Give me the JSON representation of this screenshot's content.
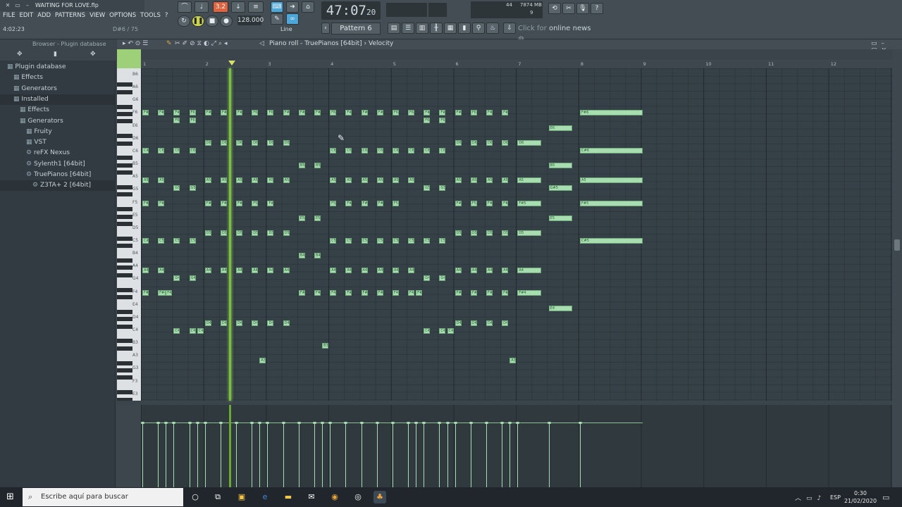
{
  "window": {
    "title": "WAITING FOR LOVE.flp",
    "hint_left": "4:02:23",
    "hint_right": "D#6 / 75"
  },
  "menu": [
    "FILE",
    "EDIT",
    "ADD",
    "PATTERNS",
    "VIEW",
    "OPTIONS",
    "TOOLS",
    "?"
  ],
  "transport": {
    "time": "47:07",
    "time_sub": "20",
    "tempo": "128.000",
    "snap": "3.2",
    "tool": "Line",
    "pattern": "Pattern 6"
  },
  "status": {
    "cpu": "44",
    "memory": "7874 MB",
    "polyphony": "9",
    "news_prefix": "Click for",
    "news_highlight": "online news"
  },
  "browser": {
    "title": "Browser - Plugin database",
    "items": [
      {
        "label": "Plugin database",
        "indent": 0,
        "icon": "folder-icon"
      },
      {
        "label": "Effects",
        "indent": 1,
        "icon": "folder-icon"
      },
      {
        "label": "Generators",
        "indent": 1,
        "icon": "folder-icon"
      },
      {
        "label": "Installed",
        "indent": 1,
        "icon": "folder-icon",
        "selected": true
      },
      {
        "label": "Effects",
        "indent": 2,
        "icon": "folder-icon"
      },
      {
        "label": "Generators",
        "indent": 2,
        "icon": "folder-icon"
      },
      {
        "label": "Fruity",
        "indent": 3,
        "icon": "folder-icon"
      },
      {
        "label": "VST",
        "indent": 3,
        "icon": "folder-icon"
      },
      {
        "label": "reFX Nexus",
        "indent": 3,
        "icon": "plugin-icon"
      },
      {
        "label": "Sylenth1 [64bit]",
        "indent": 3,
        "icon": "plugin-icon"
      },
      {
        "label": "TruePianos [64bit]",
        "indent": 3,
        "icon": "plugin-icon"
      },
      {
        "label": "Z3TA+ 2 [64bit]",
        "indent": 4,
        "icon": "plugin-icon",
        "selected": true
      }
    ]
  },
  "piano_roll": {
    "title": "Piano roll - TruePianos [64bit]",
    "separator": "›",
    "param": "Velocity",
    "bar_numbers": [
      "1",
      "2",
      "3",
      "4",
      "5",
      "6",
      "7",
      "8",
      "9",
      "10",
      "11",
      "12"
    ],
    "key_labels": [
      "B6",
      "A6",
      "G6",
      "F6",
      "E6",
      "D6",
      "C6",
      "B5",
      "A5",
      "G5",
      "F5",
      "E5",
      "D5",
      "C5",
      "B4",
      "A4",
      "G4",
      "F4",
      "E4",
      "D4",
      "C4",
      "B3",
      "A3",
      "G3",
      "F3",
      "E3"
    ],
    "notes": [
      {
        "p": "F6",
        "s": 0,
        "l": 0.4,
        "t": "F#6"
      },
      {
        "p": "F6",
        "s": 1,
        "l": 0.4,
        "t": "F#6"
      },
      {
        "p": "F6",
        "s": 2,
        "l": 0.4,
        "t": "F#6"
      },
      {
        "p": "F6",
        "s": 3,
        "l": 0.4,
        "t": "F6"
      },
      {
        "p": "F6",
        "s": 4,
        "l": 0.4,
        "t": "F#6"
      },
      {
        "p": "F6",
        "s": 5,
        "l": 0.4,
        "t": "F#6"
      },
      {
        "p": "F6",
        "s": 6,
        "l": 0.4,
        "t": "F#6"
      },
      {
        "p": "F6",
        "s": 7,
        "l": 0.4,
        "t": "F6"
      },
      {
        "p": "F6",
        "s": 8,
        "l": 0.4,
        "t": "F6"
      },
      {
        "p": "F6",
        "s": 9,
        "l": 0.4,
        "t": "F#6"
      },
      {
        "p": "F6",
        "s": 10,
        "l": 0.4,
        "t": "F#6"
      },
      {
        "p": "F6",
        "s": 11,
        "l": 0.4,
        "t": "F#6"
      },
      {
        "p": "F6",
        "s": 12,
        "l": 0.4,
        "t": "F6"
      },
      {
        "p": "F6",
        "s": 13,
        "l": 0.4,
        "t": "F#6"
      },
      {
        "p": "F6",
        "s": 14,
        "l": 0.4,
        "t": "F#6"
      },
      {
        "p": "F6",
        "s": 15,
        "l": 0.4,
        "t": "F#6"
      },
      {
        "p": "F6",
        "s": 16,
        "l": 0.4,
        "t": "F6"
      },
      {
        "p": "F6",
        "s": 17,
        "l": 0.4,
        "t": "F6"
      },
      {
        "p": "F6",
        "s": 18,
        "l": 0.4,
        "t": "F#6"
      },
      {
        "p": "F6",
        "s": 19,
        "l": 0.4,
        "t": "F#6"
      },
      {
        "p": "F6",
        "s": 20,
        "l": 0.4,
        "t": "F#6"
      },
      {
        "p": "F6",
        "s": 21,
        "l": 0.4,
        "t": "F6"
      },
      {
        "p": "F6",
        "s": 22,
        "l": 0.4,
        "t": "F#6"
      },
      {
        "p": "F6",
        "s": 23,
        "l": 0.4,
        "t": "F#6"
      },
      {
        "p": "F6",
        "s": 28,
        "l": 4,
        "t": "F#6"
      },
      {
        "p": "E6b",
        "s": 2,
        "l": 0.4,
        "t": "F6"
      },
      {
        "p": "E6b",
        "s": 3,
        "l": 0.4,
        "t": "F6"
      },
      {
        "p": "E6b",
        "s": 18,
        "l": 0.4,
        "t": "F6"
      },
      {
        "p": "E6b",
        "s": 19,
        "l": 0.4,
        "t": "F6"
      },
      {
        "p": "E6",
        "s": 26,
        "l": 1.5,
        "t": "E6"
      },
      {
        "p": "D6",
        "s": 4,
        "l": 0.4,
        "t": "D6"
      },
      {
        "p": "D6",
        "s": 5,
        "l": 0.4,
        "t": "D6"
      },
      {
        "p": "D6",
        "s": 6,
        "l": 0.4,
        "t": "D6"
      },
      {
        "p": "D6",
        "s": 7,
        "l": 0.4,
        "t": "D6"
      },
      {
        "p": "D6",
        "s": 8,
        "l": 0.4,
        "t": "D6"
      },
      {
        "p": "D6",
        "s": 9,
        "l": 0.4,
        "t": "D6"
      },
      {
        "p": "D6",
        "s": 20,
        "l": 0.4,
        "t": "D6"
      },
      {
        "p": "D6",
        "s": 21,
        "l": 0.4,
        "t": "D6"
      },
      {
        "p": "D6",
        "s": 22,
        "l": 0.4,
        "t": "D6"
      },
      {
        "p": "D6",
        "s": 23,
        "l": 0.4,
        "t": "D6"
      },
      {
        "p": "D6",
        "s": 24,
        "l": 1.5,
        "t": "D6"
      },
      {
        "p": "C6",
        "s": 0,
        "l": 0.4,
        "t": "C#6"
      },
      {
        "p": "C6",
        "s": 1,
        "l": 0.4,
        "t": "C6"
      },
      {
        "p": "C6",
        "s": 2,
        "l": 0.4,
        "t": "C6"
      },
      {
        "p": "C6",
        "s": 3,
        "l": 0.4,
        "t": "C6"
      },
      {
        "p": "C6",
        "s": 12,
        "l": 0.4,
        "t": "C6"
      },
      {
        "p": "C6",
        "s": 13,
        "l": 0.4,
        "t": "C6"
      },
      {
        "p": "C6",
        "s": 14,
        "l": 0.4,
        "t": "C6"
      },
      {
        "p": "C6",
        "s": 15,
        "l": 0.4,
        "t": "C6"
      },
      {
        "p": "C6",
        "s": 16,
        "l": 0.4,
        "t": "C6"
      },
      {
        "p": "C6",
        "s": 17,
        "l": 0.4,
        "t": "C6"
      },
      {
        "p": "C6",
        "s": 18,
        "l": 0.4,
        "t": "C6"
      },
      {
        "p": "C6",
        "s": 19,
        "l": 0.4,
        "t": "C6"
      },
      {
        "p": "C6",
        "s": 28,
        "l": 4,
        "t": "C#6"
      },
      {
        "p": "B5",
        "s": 10,
        "l": 0.4,
        "t": "B5"
      },
      {
        "p": "B5",
        "s": 11,
        "l": 0.4,
        "t": "B5"
      },
      {
        "p": "B5",
        "s": 26,
        "l": 1.5,
        "t": "B5"
      },
      {
        "p": "A5",
        "s": 0,
        "l": 0.4,
        "t": "A5"
      },
      {
        "p": "A5",
        "s": 1,
        "l": 0.4,
        "t": "A5"
      },
      {
        "p": "A5",
        "s": 4,
        "l": 0.4,
        "t": "A5"
      },
      {
        "p": "A5",
        "s": 5,
        "l": 0.4,
        "t": "A5"
      },
      {
        "p": "A5",
        "s": 6,
        "l": 0.4,
        "t": "A5"
      },
      {
        "p": "A5",
        "s": 7,
        "l": 0.4,
        "t": "A5"
      },
      {
        "p": "A5",
        "s": 8,
        "l": 0.4,
        "t": "A5"
      },
      {
        "p": "A5",
        "s": 9,
        "l": 0.4,
        "t": "A5"
      },
      {
        "p": "A5",
        "s": 12,
        "l": 0.4,
        "t": "A5"
      },
      {
        "p": "A5",
        "s": 13,
        "l": 0.4,
        "t": "A5"
      },
      {
        "p": "A5",
        "s": 14,
        "l": 0.4,
        "t": "A5"
      },
      {
        "p": "A5",
        "s": 15,
        "l": 0.4,
        "t": "A5"
      },
      {
        "p": "A5",
        "s": 16,
        "l": 0.4,
        "t": "A5"
      },
      {
        "p": "A5",
        "s": 17,
        "l": 0.4,
        "t": "A5"
      },
      {
        "p": "A5",
        "s": 20,
        "l": 0.4,
        "t": "A5"
      },
      {
        "p": "A5",
        "s": 21,
        "l": 0.4,
        "t": "A5"
      },
      {
        "p": "A5",
        "s": 22,
        "l": 0.4,
        "t": "A5"
      },
      {
        "p": "A5",
        "s": 23,
        "l": 0.4,
        "t": "A5"
      },
      {
        "p": "A5",
        "s": 24,
        "l": 1.5,
        "t": "A5"
      },
      {
        "p": "A5",
        "s": 28,
        "l": 4,
        "t": "A5"
      },
      {
        "p": "G5",
        "s": 2,
        "l": 0.4,
        "t": "G5"
      },
      {
        "p": "G5",
        "s": 3,
        "l": 0.4,
        "t": "G5"
      },
      {
        "p": "G5",
        "s": 18,
        "l": 0.4,
        "t": "G5"
      },
      {
        "p": "G5",
        "s": 19,
        "l": 0.4,
        "t": "G5"
      },
      {
        "p": "G5",
        "s": 26,
        "l": 1.5,
        "t": "G#5"
      },
      {
        "p": "F5",
        "s": 0,
        "l": 0.4,
        "t": "F#5"
      },
      {
        "p": "F5",
        "s": 1,
        "l": 0.4,
        "t": "F#5"
      },
      {
        "p": "F5",
        "s": 4,
        "l": 0.4,
        "t": "F#5"
      },
      {
        "p": "F5",
        "s": 5,
        "l": 0.4,
        "t": "F#5"
      },
      {
        "p": "F5",
        "s": 6,
        "l": 0.4,
        "t": "F#5"
      },
      {
        "p": "F5",
        "s": 7,
        "l": 0.4,
        "t": "F5"
      },
      {
        "p": "F5",
        "s": 8,
        "l": 0.4,
        "t": "F#5"
      },
      {
        "p": "F5",
        "s": 12,
        "l": 0.4,
        "t": "F5"
      },
      {
        "p": "F5",
        "s": 13,
        "l": 0.4,
        "t": "F#5"
      },
      {
        "p": "F5",
        "s": 14,
        "l": 0.4,
        "t": "F#5"
      },
      {
        "p": "F5",
        "s": 15,
        "l": 0.4,
        "t": "F#5"
      },
      {
        "p": "F5",
        "s": 16,
        "l": 0.4,
        "t": "F5"
      },
      {
        "p": "F5",
        "s": 20,
        "l": 0.4,
        "t": "F#5"
      },
      {
        "p": "F5",
        "s": 21,
        "l": 0.4,
        "t": "F5"
      },
      {
        "p": "F5",
        "s": 22,
        "l": 0.4,
        "t": "F#5"
      },
      {
        "p": "F5",
        "s": 23,
        "l": 0.4,
        "t": "F#5"
      },
      {
        "p": "F5",
        "s": 24,
        "l": 1.5,
        "t": "F#5"
      },
      {
        "p": "F5",
        "s": 28,
        "l": 4,
        "t": "F#5"
      },
      {
        "p": "E5",
        "s": 10,
        "l": 0.4,
        "t": "E5"
      },
      {
        "p": "E5",
        "s": 11,
        "l": 0.4,
        "t": "E5"
      },
      {
        "p": "E5",
        "s": 26,
        "l": 1.5,
        "t": "E5"
      },
      {
        "p": "D5",
        "s": 4,
        "l": 0.4,
        "t": "D5"
      },
      {
        "p": "D5",
        "s": 5,
        "l": 0.4,
        "t": "D5"
      },
      {
        "p": "D5",
        "s": 6,
        "l": 0.4,
        "t": "D5"
      },
      {
        "p": "D5",
        "s": 7,
        "l": 0.4,
        "t": "D5"
      },
      {
        "p": "D5",
        "s": 8,
        "l": 0.4,
        "t": "D5"
      },
      {
        "p": "D5",
        "s": 9,
        "l": 0.4,
        "t": "D5"
      },
      {
        "p": "D5",
        "s": 20,
        "l": 0.4,
        "t": "D5"
      },
      {
        "p": "D5",
        "s": 21,
        "l": 0.4,
        "t": "D5"
      },
      {
        "p": "D5",
        "s": 22,
        "l": 0.4,
        "t": "D5"
      },
      {
        "p": "D5",
        "s": 23,
        "l": 0.4,
        "t": "D5"
      },
      {
        "p": "D5",
        "s": 24,
        "l": 1.5,
        "t": "D5"
      },
      {
        "p": "C5",
        "s": 0,
        "l": 0.4,
        "t": "C#5"
      },
      {
        "p": "C5",
        "s": 1,
        "l": 0.4,
        "t": "C5"
      },
      {
        "p": "C5",
        "s": 2,
        "l": 0.4,
        "t": "C5"
      },
      {
        "p": "C5",
        "s": 3,
        "l": 0.4,
        "t": "C5"
      },
      {
        "p": "C5",
        "s": 12,
        "l": 0.4,
        "t": "C5"
      },
      {
        "p": "C5",
        "s": 13,
        "l": 0.4,
        "t": "C5"
      },
      {
        "p": "C5",
        "s": 14,
        "l": 0.4,
        "t": "C5"
      },
      {
        "p": "C5",
        "s": 15,
        "l": 0.4,
        "t": "C5"
      },
      {
        "p": "C5",
        "s": 16,
        "l": 0.4,
        "t": "C5"
      },
      {
        "p": "C5",
        "s": 17,
        "l": 0.4,
        "t": "C5"
      },
      {
        "p": "C5",
        "s": 18,
        "l": 0.4,
        "t": "C5"
      },
      {
        "p": "C5",
        "s": 19,
        "l": 0.4,
        "t": "C5"
      },
      {
        "p": "C5",
        "s": 28,
        "l": 4,
        "t": "C#5"
      },
      {
        "p": "B4",
        "s": 10,
        "l": 0.4,
        "t": "B4"
      },
      {
        "p": "B4",
        "s": 11,
        "l": 0.4,
        "t": "B4"
      },
      {
        "p": "A4",
        "s": 0,
        "l": 0.4,
        "t": "A4"
      },
      {
        "p": "A4",
        "s": 1,
        "l": 0.4,
        "t": "A4"
      },
      {
        "p": "A4",
        "s": 4,
        "l": 0.4,
        "t": "A4"
      },
      {
        "p": "A4",
        "s": 5,
        "l": 0.4,
        "t": "A4"
      },
      {
        "p": "A4",
        "s": 6,
        "l": 0.4,
        "t": "A4"
      },
      {
        "p": "A4",
        "s": 7,
        "l": 0.4,
        "t": "A4"
      },
      {
        "p": "A4",
        "s": 8,
        "l": 0.4,
        "t": "A4"
      },
      {
        "p": "A4",
        "s": 9,
        "l": 0.4,
        "t": "A4"
      },
      {
        "p": "A4",
        "s": 12,
        "l": 0.4,
        "t": "A4"
      },
      {
        "p": "A4",
        "s": 13,
        "l": 0.4,
        "t": "A4"
      },
      {
        "p": "A4",
        "s": 14,
        "l": 0.4,
        "t": "A4"
      },
      {
        "p": "A4",
        "s": 15,
        "l": 0.4,
        "t": "A4"
      },
      {
        "p": "A4",
        "s": 16,
        "l": 0.4,
        "t": "A4"
      },
      {
        "p": "A4",
        "s": 17,
        "l": 0.4,
        "t": "A4"
      },
      {
        "p": "A4",
        "s": 20,
        "l": 0.4,
        "t": "A4"
      },
      {
        "p": "A4",
        "s": 21,
        "l": 0.4,
        "t": "A4"
      },
      {
        "p": "A4",
        "s": 22,
        "l": 0.4,
        "t": "A4"
      },
      {
        "p": "A4",
        "s": 23,
        "l": 0.4,
        "t": "A4"
      },
      {
        "p": "A4",
        "s": 24,
        "l": 1.5,
        "t": "A4"
      },
      {
        "p": "G4",
        "s": 2,
        "l": 0.4,
        "t": "G4"
      },
      {
        "p": "G4",
        "s": 3,
        "l": 0.4,
        "t": "G4"
      },
      {
        "p": "G4",
        "s": 18,
        "l": 0.4,
        "t": "G4"
      },
      {
        "p": "G4",
        "s": 19,
        "l": 0.4,
        "t": "G4"
      },
      {
        "p": "F4",
        "s": 0,
        "l": 0.4,
        "t": "F#4"
      },
      {
        "p": "F4",
        "s": 1,
        "l": 0.5,
        "t": "F#4"
      },
      {
        "p": "F4",
        "s": 1.5,
        "l": 0.4,
        "t": "F4"
      },
      {
        "p": "F4",
        "s": 10,
        "l": 0.4,
        "t": "F#4"
      },
      {
        "p": "F4",
        "s": 11,
        "l": 0.4,
        "t": "F#4"
      },
      {
        "p": "F4",
        "s": 12,
        "l": 0.4,
        "t": "F4"
      },
      {
        "p": "F4",
        "s": 13,
        "l": 0.4,
        "t": "F#4"
      },
      {
        "p": "F4",
        "s": 14,
        "l": 0.4,
        "t": "F#4"
      },
      {
        "p": "F4",
        "s": 15,
        "l": 0.4,
        "t": "F#4"
      },
      {
        "p": "F4",
        "s": 16,
        "l": 0.4,
        "t": "F4"
      },
      {
        "p": "F4",
        "s": 17,
        "l": 0.4,
        "t": "F4"
      },
      {
        "p": "F4",
        "s": 17.5,
        "l": 0.4,
        "t": "F#4"
      },
      {
        "p": "F4",
        "s": 20,
        "l": 0.4,
        "t": "F#4"
      },
      {
        "p": "F4",
        "s": 21,
        "l": 0.4,
        "t": "F#4"
      },
      {
        "p": "F4",
        "s": 22,
        "l": 0.4,
        "t": "F#4"
      },
      {
        "p": "F4",
        "s": 23,
        "l": 0.4,
        "t": "F#4"
      },
      {
        "p": "F4",
        "s": 24,
        "l": 1.5,
        "t": "F#4"
      },
      {
        "p": "E4",
        "s": 26,
        "l": 1.5,
        "t": "E4"
      },
      {
        "p": "D4",
        "s": 4,
        "l": 0.4,
        "t": "D4"
      },
      {
        "p": "D4",
        "s": 5,
        "l": 0.4,
        "t": "D4"
      },
      {
        "p": "D4",
        "s": 6,
        "l": 0.4,
        "t": "D4"
      },
      {
        "p": "D4",
        "s": 7,
        "l": 0.4,
        "t": "D4"
      },
      {
        "p": "D4",
        "s": 8,
        "l": 0.4,
        "t": "D4"
      },
      {
        "p": "D4",
        "s": 9,
        "l": 0.4,
        "t": "D4"
      },
      {
        "p": "D4",
        "s": 20,
        "l": 0.4,
        "t": "D4"
      },
      {
        "p": "D4",
        "s": 21,
        "l": 0.4,
        "t": "D4"
      },
      {
        "p": "D4",
        "s": 22,
        "l": 0.4,
        "t": "D4"
      },
      {
        "p": "D4",
        "s": 23,
        "l": 0.4,
        "t": "D4"
      },
      {
        "p": "C4",
        "s": 2,
        "l": 0.4,
        "t": "C4"
      },
      {
        "p": "C4",
        "s": 3,
        "l": 0.4,
        "t": "C4"
      },
      {
        "p": "C4",
        "s": 3.5,
        "l": 0.4,
        "t": "C4"
      },
      {
        "p": "C4",
        "s": 18,
        "l": 0.4,
        "t": "C4"
      },
      {
        "p": "C4",
        "s": 19,
        "l": 0.4,
        "t": "C4"
      },
      {
        "p": "C4",
        "s": 19.5,
        "l": 0.4,
        "t": "C4"
      },
      {
        "p": "B3",
        "s": 11.5,
        "l": 0.4,
        "t": "B3"
      },
      {
        "p": "A3",
        "s": 7.5,
        "l": 0.4,
        "t": "A3"
      },
      {
        "p": "A3",
        "s": 23.5,
        "l": 0.4,
        "t": "A3"
      }
    ]
  },
  "taskbar": {
    "search_placeholder": "Escribe aquí para buscar",
    "time": "0:30",
    "date": "21/02/2020",
    "lang": "ESP"
  },
  "colors": {
    "note": "#a7ddb0",
    "playhead": "#7bbf3a",
    "grid_bg": "#364147"
  }
}
